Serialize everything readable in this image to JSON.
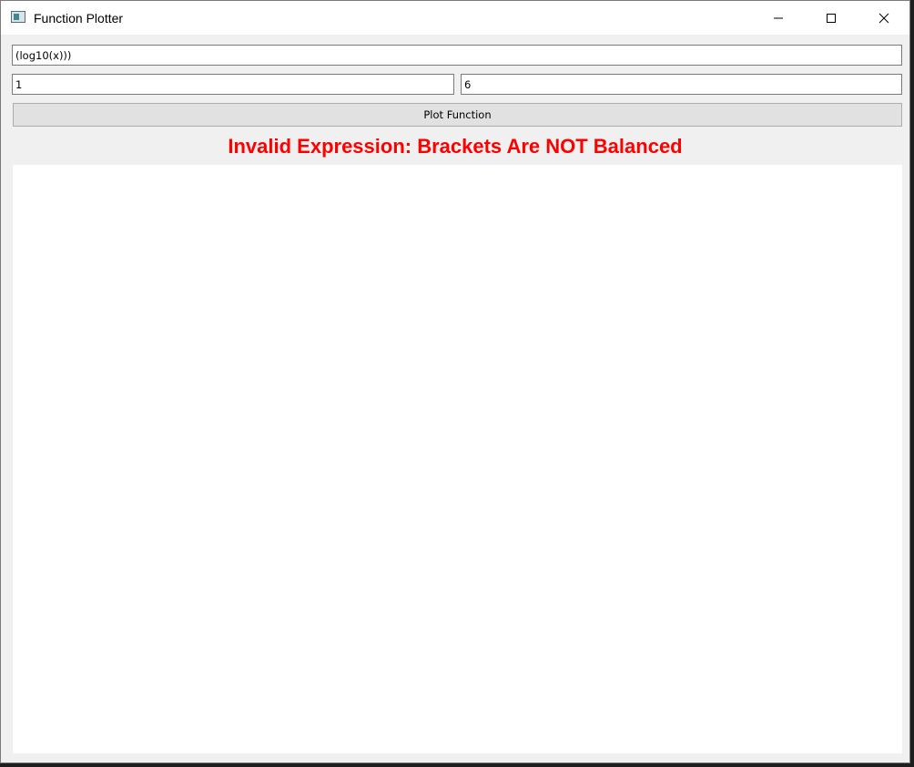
{
  "window": {
    "title": "Function Plotter"
  },
  "inputs": {
    "expression_value": "(log10(x)))",
    "x_min_value": "1",
    "x_max_value": "6"
  },
  "plot_button": {
    "label": "Plot Function"
  },
  "status": {
    "error_text": "Invalid Expression: Brackets Are NOT Balanced",
    "error_color": "#ff0000"
  },
  "icons": {
    "app": "app-window-icon",
    "minimize": "minimize-icon",
    "maximize": "maximize-icon",
    "close": "close-icon"
  }
}
